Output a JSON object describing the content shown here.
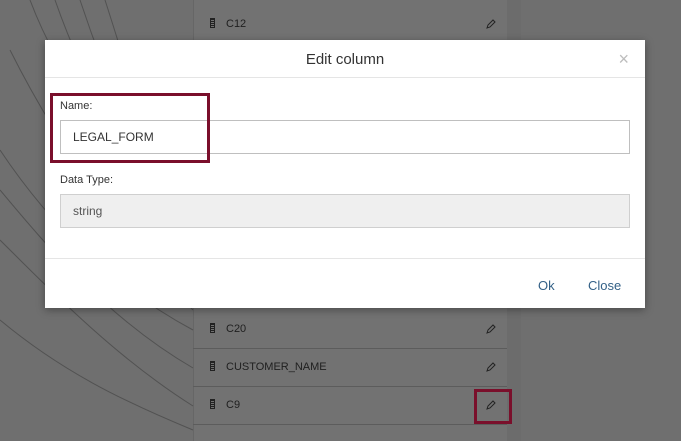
{
  "columns": {
    "top_row": {
      "label": "C12"
    },
    "rows": [
      {
        "label": "C20"
      },
      {
        "label": "CUSTOMER_NAME"
      },
      {
        "label": "C9"
      }
    ]
  },
  "dialog": {
    "title": "Edit column",
    "close_icon": "×",
    "name_label": "Name:",
    "name_value": "LEGAL_FORM",
    "type_label": "Data Type:",
    "type_value": "string",
    "ok_label": "Ok",
    "close_label": "Close"
  },
  "colors": {
    "highlight": "#7a0f2b",
    "link": "#346187"
  }
}
